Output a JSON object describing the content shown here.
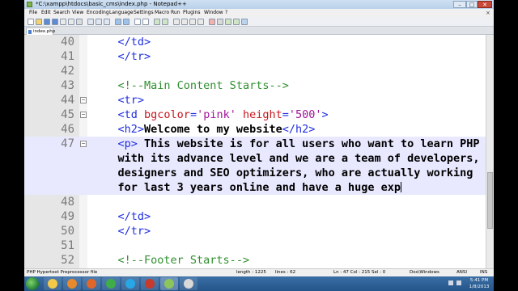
{
  "window": {
    "title": "*C:\\xampp\\htdocs\\basic_cms\\index.php - Notepad++",
    "min_glyph": "–",
    "max_glyph": "□",
    "close_glyph": "✕"
  },
  "menu": {
    "items": [
      "File",
      "Edit",
      "Search",
      "View",
      "Encoding",
      "Language",
      "Settings",
      "Macro",
      "Run",
      "Plugins",
      "Window",
      "?"
    ],
    "close_glyph": "×"
  },
  "tab": {
    "label": "index.php"
  },
  "editor": {
    "lines": [
      {
        "num": "40",
        "fold": false,
        "highlighted": false,
        "segments": [
          {
            "t": "    ",
            "c": "plain"
          },
          {
            "t": "</td>",
            "c": "tag"
          }
        ]
      },
      {
        "num": "41",
        "fold": false,
        "highlighted": false,
        "segments": [
          {
            "t": "    ",
            "c": "plain"
          },
          {
            "t": "</tr>",
            "c": "tag"
          }
        ]
      },
      {
        "num": "42",
        "fold": false,
        "highlighted": false,
        "segments": []
      },
      {
        "num": "43",
        "fold": false,
        "highlighted": false,
        "segments": [
          {
            "t": "    ",
            "c": "plain"
          },
          {
            "t": "<!--Main Content Starts-->",
            "c": "cmt"
          }
        ]
      },
      {
        "num": "44",
        "fold": true,
        "highlighted": false,
        "segments": [
          {
            "t": "    ",
            "c": "plain"
          },
          {
            "t": "<tr>",
            "c": "tag"
          }
        ]
      },
      {
        "num": "45",
        "fold": true,
        "highlighted": false,
        "segments": [
          {
            "t": "    ",
            "c": "plain"
          },
          {
            "t": "<td ",
            "c": "tag"
          },
          {
            "t": "bgcolor",
            "c": "attr"
          },
          {
            "t": "=",
            "c": "tag"
          },
          {
            "t": "'pink'",
            "c": "val"
          },
          {
            "t": " height",
            "c": "attr"
          },
          {
            "t": "=",
            "c": "tag"
          },
          {
            "t": "'500'",
            "c": "val"
          },
          {
            "t": ">",
            "c": "tag"
          }
        ]
      },
      {
        "num": "46",
        "fold": false,
        "highlighted": false,
        "segments": [
          {
            "t": "    ",
            "c": "plain"
          },
          {
            "t": "<h2>",
            "c": "tag"
          },
          {
            "t": "Welcome to my website",
            "c": "txt"
          },
          {
            "t": "</h2>",
            "c": "tag"
          }
        ]
      },
      {
        "num": "47",
        "fold": true,
        "highlighted": true,
        "segments": [
          {
            "t": "    ",
            "c": "plain"
          },
          {
            "t": "<p>",
            "c": "tag"
          },
          {
            "t": " This website is for all users who want to learn PHP",
            "c": "txt"
          }
        ]
      },
      {
        "num": "",
        "fold": false,
        "highlighted": true,
        "segments": [
          {
            "t": "    ",
            "c": "plain"
          },
          {
            "t": "with its advance level and we are a team of developers,",
            "c": "txt"
          }
        ]
      },
      {
        "num": "",
        "fold": false,
        "highlighted": true,
        "segments": [
          {
            "t": "    ",
            "c": "plain"
          },
          {
            "t": "designers and SEO optimizers, who are actually working",
            "c": "txt"
          }
        ]
      },
      {
        "num": "",
        "fold": false,
        "highlighted": true,
        "segments": [
          {
            "t": "    ",
            "c": "plain"
          },
          {
            "t": "for last 3 years online and have a huge exp",
            "c": "txt"
          }
        ],
        "cursor": true
      },
      {
        "num": "48",
        "fold": false,
        "highlighted": false,
        "segments": []
      },
      {
        "num": "49",
        "fold": false,
        "highlighted": false,
        "segments": [
          {
            "t": "    ",
            "c": "plain"
          },
          {
            "t": "</td>",
            "c": "tag"
          }
        ]
      },
      {
        "num": "50",
        "fold": false,
        "highlighted": false,
        "segments": [
          {
            "t": "    ",
            "c": "plain"
          },
          {
            "t": "</tr>",
            "c": "tag"
          }
        ]
      },
      {
        "num": "51",
        "fold": false,
        "highlighted": false,
        "segments": []
      },
      {
        "num": "52",
        "fold": false,
        "highlighted": false,
        "segments": [
          {
            "t": "    ",
            "c": "plain"
          },
          {
            "t": "<!--Footer Starts-->",
            "c": "cmt"
          }
        ]
      }
    ]
  },
  "status": {
    "file_type": "PHP Hypertext Preprocessor file",
    "length": "length : 1225",
    "lines": "lines : 62",
    "position": "Ln : 47   Col : 215   Sel : 0",
    "eol": "Dos\\Windows",
    "encoding": "ANSI",
    "mode": "INS"
  },
  "taskbar": {
    "time": "5:41 PM",
    "date": "1/8/2013",
    "apps": [
      "explorer-icon",
      "media-player-icon",
      "firefox-icon",
      "chrome-icon",
      "skype-icon",
      "filezilla-icon",
      "notepadpp-icon",
      "paint-icon"
    ]
  },
  "colors": {
    "tag": "#1f2ee0",
    "comment": "#2f8f2f",
    "attribute": "#c9181e",
    "attr_value": "#a2149a",
    "current_line": "#e8e8ff",
    "gutter": "#e6e6e6",
    "taskbar": "#2b5f96"
  }
}
